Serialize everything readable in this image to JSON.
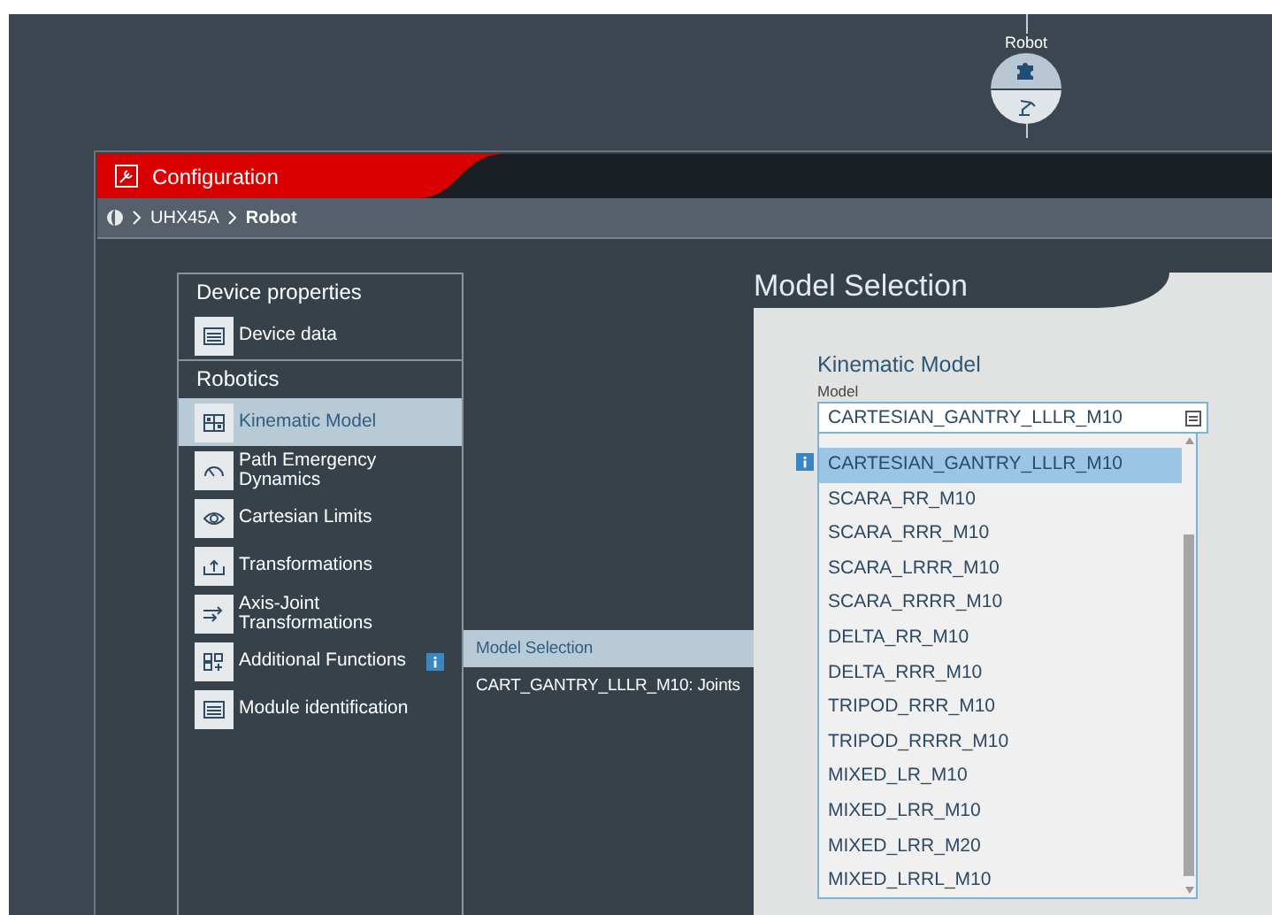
{
  "canvas": {
    "node": {
      "label": "Robot"
    }
  },
  "window": {
    "title": "Configuration",
    "breadcrumb": [
      {
        "label": "UHX45A",
        "current": false
      },
      {
        "label": "Robot",
        "current": true
      }
    ]
  },
  "sidebar": {
    "groups": [
      {
        "title": "Device properties",
        "items": [
          {
            "label": "Device data",
            "selected": false,
            "info": false
          }
        ]
      },
      {
        "title": "Robotics",
        "items": [
          {
            "label": "Kinematic Model",
            "selected": true,
            "info": false
          },
          {
            "label": "Path Emergency Dynamics",
            "selected": false,
            "info": false
          },
          {
            "label": "Cartesian Limits",
            "selected": false,
            "info": false
          },
          {
            "label": "Transformations",
            "selected": false,
            "info": false
          },
          {
            "label": "Axis-Joint Transformations",
            "selected": false,
            "info": false
          },
          {
            "label": "Additional Functions",
            "selected": false,
            "info": true
          },
          {
            "label": "Module identification",
            "selected": false,
            "info": false
          }
        ]
      }
    ]
  },
  "subnav": {
    "items": [
      {
        "label": "Model Selection",
        "selected": true
      },
      {
        "label": "CART_GANTRY_LLLR_M10: Joints",
        "selected": false
      }
    ]
  },
  "panel": {
    "title": "Model Selection",
    "section": "Kinematic Model",
    "field": {
      "label": "Model",
      "value": "CARTESIAN_GANTRY_LLLR_M10",
      "expanded": true,
      "info": true
    },
    "options": [
      {
        "label": "CARTESIAN_GANTRY_LLLR_M10",
        "selected": true
      },
      {
        "label": "SCARA_RR_M10",
        "selected": false
      },
      {
        "label": "SCARA_RRR_M10",
        "selected": false
      },
      {
        "label": "SCARA_LRRR_M10",
        "selected": false
      },
      {
        "label": "SCARA_RRRR_M10",
        "selected": false
      },
      {
        "label": "DELTA_RR_M10",
        "selected": false
      },
      {
        "label": "DELTA_RRR_M10",
        "selected": false
      },
      {
        "label": "TRIPOD_RRR_M10",
        "selected": false
      },
      {
        "label": "TRIPOD_RRRR_M10",
        "selected": false
      },
      {
        "label": "MIXED_LR_M10",
        "selected": false
      },
      {
        "label": "MIXED_LRR_M10",
        "selected": false
      },
      {
        "label": "MIXED_LRR_M20",
        "selected": false
      },
      {
        "label": "MIXED_LRRL_M10",
        "selected": false
      }
    ]
  }
}
